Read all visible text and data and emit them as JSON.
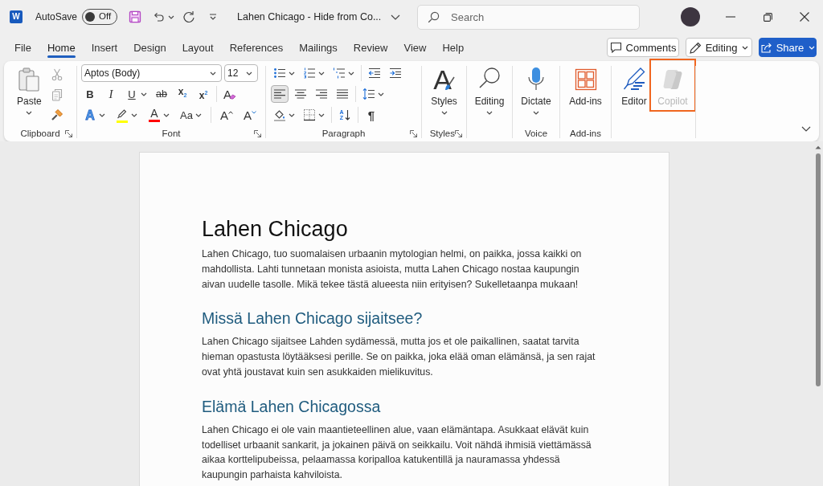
{
  "title_bar": {
    "logo": "W",
    "autosave_label": "AutoSave",
    "autosave": {
      "on": false,
      "label": "Off"
    },
    "document_title": "Lahen Chicago - Hide from Co...",
    "search": {
      "placeholder": "Search"
    }
  },
  "menu_tabs": [
    {
      "label": "File",
      "selected": false
    },
    {
      "label": "Home",
      "selected": true
    },
    {
      "label": "Insert",
      "selected": false
    },
    {
      "label": "Design",
      "selected": false
    },
    {
      "label": "Layout",
      "selected": false
    },
    {
      "label": "References",
      "selected": false
    },
    {
      "label": "Mailings",
      "selected": false
    },
    {
      "label": "Review",
      "selected": false
    },
    {
      "label": "View",
      "selected": false
    },
    {
      "label": "Help",
      "selected": false
    }
  ],
  "header_buttons": [
    {
      "kind": "comments",
      "label": "Comments"
    },
    {
      "kind": "editing",
      "label": "Editing",
      "dropdown": true
    },
    {
      "kind": "share",
      "label": "Share",
      "dropdown": true
    }
  ],
  "ribbon": {
    "groups": [
      {
        "kind": "clipboard",
        "label": "Clipboard",
        "launcher": true,
        "buttons": [
          {
            "kind": "paste",
            "label": "Paste",
            "dropdown": true
          }
        ],
        "small_tools": [
          {
            "kind": "cut",
            "disabled": true
          },
          {
            "kind": "copy",
            "disabled": true
          },
          {
            "kind": "format_painter",
            "disabled": false
          }
        ]
      },
      {
        "kind": "font",
        "label": "Font",
        "launcher": true,
        "font_name": "Aptos (Body)",
        "font_size": "12",
        "tool_rows": [
          {
            "tools": [
              {
                "kind": "bold",
                "glyph": "B"
              },
              {
                "kind": "italic",
                "glyph": "I"
              },
              {
                "kind": "underline",
                "glyph": "U",
                "dropdown": true
              },
              {
                "kind": "strikethrough",
                "glyph": "ab"
              },
              {
                "kind": "subscript",
                "glyph": "x$_{2}$"
              },
              {
                "kind": "superscript",
                "glyph": "x$^{2}$"
              },
              {
                "kind": "separator"
              },
              {
                "kind": "clear_formatting",
                "glyph": "A"
              }
            ]
          },
          {
            "tools": [
              {
                "kind": "text_effects",
                "glyph": "A",
                "dropdown": true
              },
              {
                "kind": "highlight",
                "dropdown": true,
                "color": "#ffff00"
              },
              {
                "kind": "font_color",
                "glyph": "A",
                "dropdown": true,
                "color": "#ff0000"
              },
              {
                "kind": "change_case",
                "glyph": "Aa",
                "dropdown": true
              },
              {
                "kind": "separator"
              },
              {
                "kind": "grow_font",
                "glyph": "A"
              },
              {
                "kind": "shrink_font",
                "glyph": "A"
              }
            ]
          }
        ]
      },
      {
        "kind": "paragraph",
        "label": "Paragraph",
        "launcher": true,
        "tool_rows": [
          {
            "tools": [
              {
                "kind": "bullets",
                "dropdown": true
              },
              {
                "kind": "numbering",
                "dropdown": true
              },
              {
                "kind": "multilevel",
                "dropdown": true
              },
              {
                "kind": "separator"
              },
              {
                "kind": "decrease_indent"
              },
              {
                "kind": "increase_indent"
              }
            ]
          },
          {
            "tools": [
              {
                "kind": "align_left",
                "selected": true
              },
              {
                "kind": "align_center",
                "selected": false
              },
              {
                "kind": "align_right",
                "selected": false
              },
              {
                "kind": "justify",
                "selected": false
              },
              {
                "kind": "separator"
              },
              {
                "kind": "line_spacing",
                "dropdown": true
              }
            ]
          },
          {
            "tools": [
              {
                "kind": "shading",
                "dropdown": true
              },
              {
                "kind": "borders",
                "dropdown": true
              },
              {
                "kind": "separator"
              },
              {
                "kind": "sort",
                "glyph": "A Z"
              },
              {
                "kind": "separator"
              },
              {
                "kind": "show_marks",
                "glyph": "¶"
              }
            ]
          }
        ]
      },
      {
        "kind": "styles",
        "label": "Styles",
        "launcher": true,
        "buttons": [
          {
            "kind": "styles",
            "glyph": "A",
            "label": "Styles",
            "dropdown": true
          }
        ]
      },
      {
        "kind": "editing",
        "buttons": [
          {
            "kind": "find",
            "label": "Editing",
            "dropdown": true
          }
        ]
      },
      {
        "kind": "voice",
        "label": "Voice",
        "buttons": [
          {
            "kind": "dictate",
            "label": "Dictate",
            "dropdown": true
          }
        ]
      },
      {
        "kind": "addins",
        "label": "Add-ins",
        "buttons": [
          {
            "kind": "addins",
            "label": "Add-ins"
          }
        ]
      },
      {
        "kind": "assist",
        "buttons": [
          {
            "kind": "editor",
            "label": "Editor",
            "disabled": false,
            "highlighted": false
          },
          {
            "kind": "copilot",
            "label": "Copilot",
            "disabled": true,
            "highlighted": true
          }
        ]
      }
    ]
  },
  "document": {
    "blocks": [
      {
        "kind": "title",
        "text": "Lahen Chicago"
      },
      {
        "kind": "paragraph",
        "text": "Lahen Chicago, tuo suomalaisen urbaanin mytologian helmi, on paikka, jossa kaikki on mahdollista. Lahti tunnetaan monista asioista, mutta Lahen Chicago nostaa kaupungin aivan uudelle tasolle. Mikä tekee tästä alueesta niin erityisen? Sukelletaanpa mukaan!"
      },
      {
        "kind": "heading",
        "text": "Missä Lahen Chicago sijaitsee?"
      },
      {
        "kind": "paragraph",
        "text": "Lahen Chicago sijaitsee Lahden sydämessä, mutta jos et ole paikallinen, saatat tarvita hieman opastusta löytääksesi perille. Se on paikka, joka elää oman elämänsä, ja sen rajat ovat yhtä joustavat kuin sen asukkaiden mielikuvitus."
      },
      {
        "kind": "heading",
        "text": "Elämä Lahen Chicagossa"
      },
      {
        "kind": "paragraph",
        "text": "Lahen Chicago ei ole vain maantieteellinen alue, vaan elämäntapa. Asukkaat elävät kuin todelliset urbaanit sankarit, ja jokainen päivä on seikkailu. Voit nähdä ihmisiä viettämässä aikaa korttelipubeissa, pelaamassa koripalloa katukentillä ja nauramassa yhdessä kaupungin parhaista kahviloista."
      }
    ]
  }
}
